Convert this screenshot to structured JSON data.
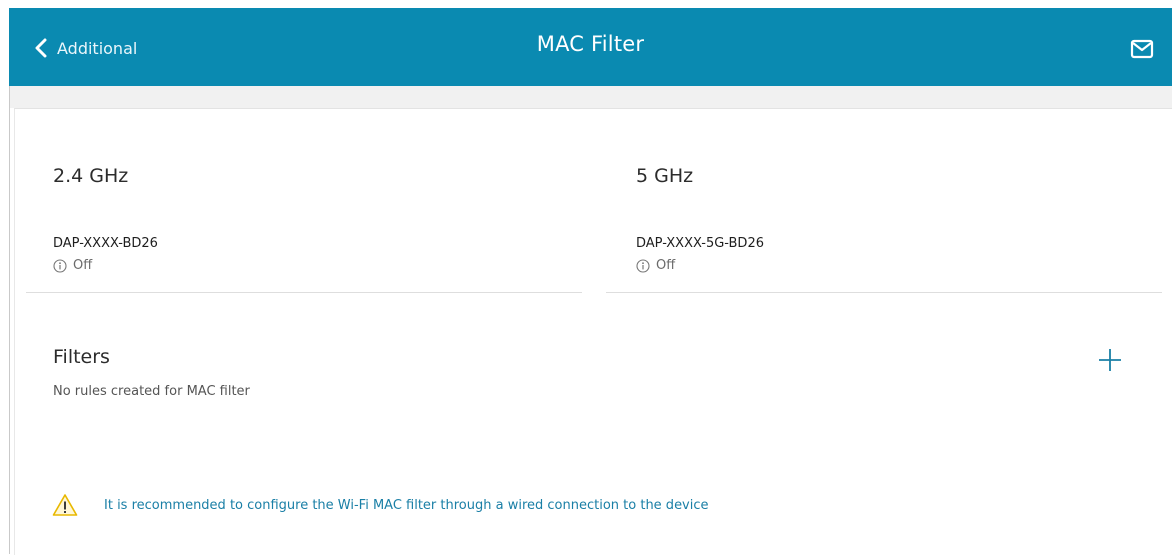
{
  "header": {
    "back_label": "Additional",
    "title": "MAC Filter",
    "mail_icon": "mail-icon",
    "color": "#0a8ab1"
  },
  "bands": [
    {
      "title": "2.4 GHz",
      "ssid": "DAP-XXXX-BD26",
      "status": "Off"
    },
    {
      "title": "5 GHz",
      "ssid": "DAP-XXXX-5G-BD26",
      "status": "Off"
    }
  ],
  "filters": {
    "title": "Filters",
    "empty_text": "No rules created for MAC filter",
    "add_icon": "plus-icon"
  },
  "warning": {
    "text": "It is recommended to configure the Wi-Fi MAC filter through a wired connection to the device",
    "icon": "warning-triangle-icon"
  }
}
